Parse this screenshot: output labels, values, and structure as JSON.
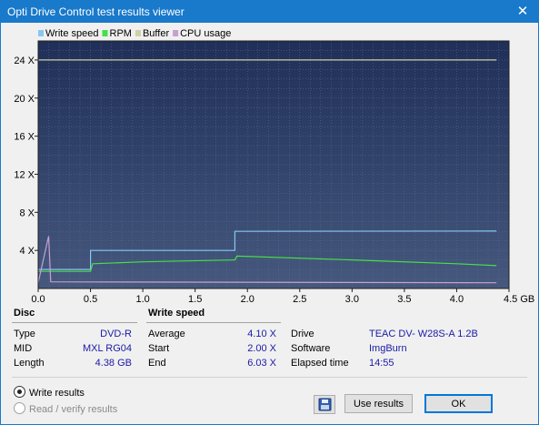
{
  "window": {
    "title": "Opti Drive Control test results viewer",
    "close_glyph": "✕"
  },
  "legend": [
    {
      "label": "Write speed",
      "color": "#86c8f0"
    },
    {
      "label": "RPM",
      "color": "#46e046"
    },
    {
      "label": "Buffer",
      "color": "#cfd0a8"
    },
    {
      "label": "CPU usage",
      "color": "#c8a0d0"
    }
  ],
  "chart_data": {
    "type": "line",
    "x_unit": "GB",
    "xlim": [
      0,
      4.5
    ],
    "ylim": [
      0,
      26
    ],
    "x_ticks": [
      {
        "v": 0,
        "t": "0.0"
      },
      {
        "v": 0.5,
        "t": "0.5"
      },
      {
        "v": 1,
        "t": "1.0"
      },
      {
        "v": 1.5,
        "t": "1.5"
      },
      {
        "v": 2,
        "t": "2.0"
      },
      {
        "v": 2.5,
        "t": "2.5"
      },
      {
        "v": 3,
        "t": "3.0"
      },
      {
        "v": 3.5,
        "t": "3.5"
      },
      {
        "v": 4,
        "t": "4.0"
      },
      {
        "v": 4.5,
        "t": "4.5 GB"
      }
    ],
    "y_ticks": [
      {
        "v": 4,
        "t": "4 X"
      },
      {
        "v": 8,
        "t": "8 X"
      },
      {
        "v": 12,
        "t": "12 X"
      },
      {
        "v": 16,
        "t": "16 X"
      },
      {
        "v": 20,
        "t": "20 X"
      },
      {
        "v": 24,
        "t": "24 X"
      }
    ],
    "grid": true,
    "series": [
      {
        "name": "Write speed",
        "points": [
          [
            0,
            2.0
          ],
          [
            0.5,
            2.0
          ],
          [
            0.5,
            4.0
          ],
          [
            1.88,
            4.0
          ],
          [
            1.88,
            6.0
          ],
          [
            4.38,
            6.03
          ]
        ]
      },
      {
        "name": "RPM",
        "points": [
          [
            0,
            1.8
          ],
          [
            0.5,
            1.8
          ],
          [
            0.52,
            2.6
          ],
          [
            1.0,
            2.8
          ],
          [
            1.88,
            3.0
          ],
          [
            1.9,
            3.4
          ],
          [
            3.0,
            3.0
          ],
          [
            4.0,
            2.6
          ],
          [
            4.38,
            2.4
          ]
        ]
      },
      {
        "name": "Buffer",
        "points": [
          [
            0,
            24
          ],
          [
            4.38,
            24
          ]
        ]
      },
      {
        "name": "CPU usage",
        "points": [
          [
            0,
            0.6
          ],
          [
            0.1,
            5.5
          ],
          [
            0.12,
            0.7
          ],
          [
            4.38,
            0.6
          ]
        ]
      }
    ]
  },
  "disc": {
    "heading": "Disc",
    "rows": [
      {
        "label": "Type",
        "value": "DVD-R"
      },
      {
        "label": "MID",
        "value": "MXL RG04"
      },
      {
        "label": "Length",
        "value": "4.38 GB"
      }
    ]
  },
  "write_speed": {
    "heading": "Write speed",
    "rows": [
      {
        "label": "Average",
        "value": "4.10 X"
      },
      {
        "label": "Start",
        "value": "2.00 X"
      },
      {
        "label": "End",
        "value": "6.03 X"
      }
    ]
  },
  "info": {
    "rows": [
      {
        "label": "Drive",
        "value": "TEAC DV- W28S-A 1.2B"
      },
      {
        "label": "Software",
        "value": "ImgBurn"
      },
      {
        "label": "Elapsed time",
        "value": "14:55"
      }
    ]
  },
  "radios": {
    "write_results": "Write results",
    "read_verify": "Read / verify results"
  },
  "buttons": {
    "use_results": "Use results",
    "ok": "OK"
  }
}
